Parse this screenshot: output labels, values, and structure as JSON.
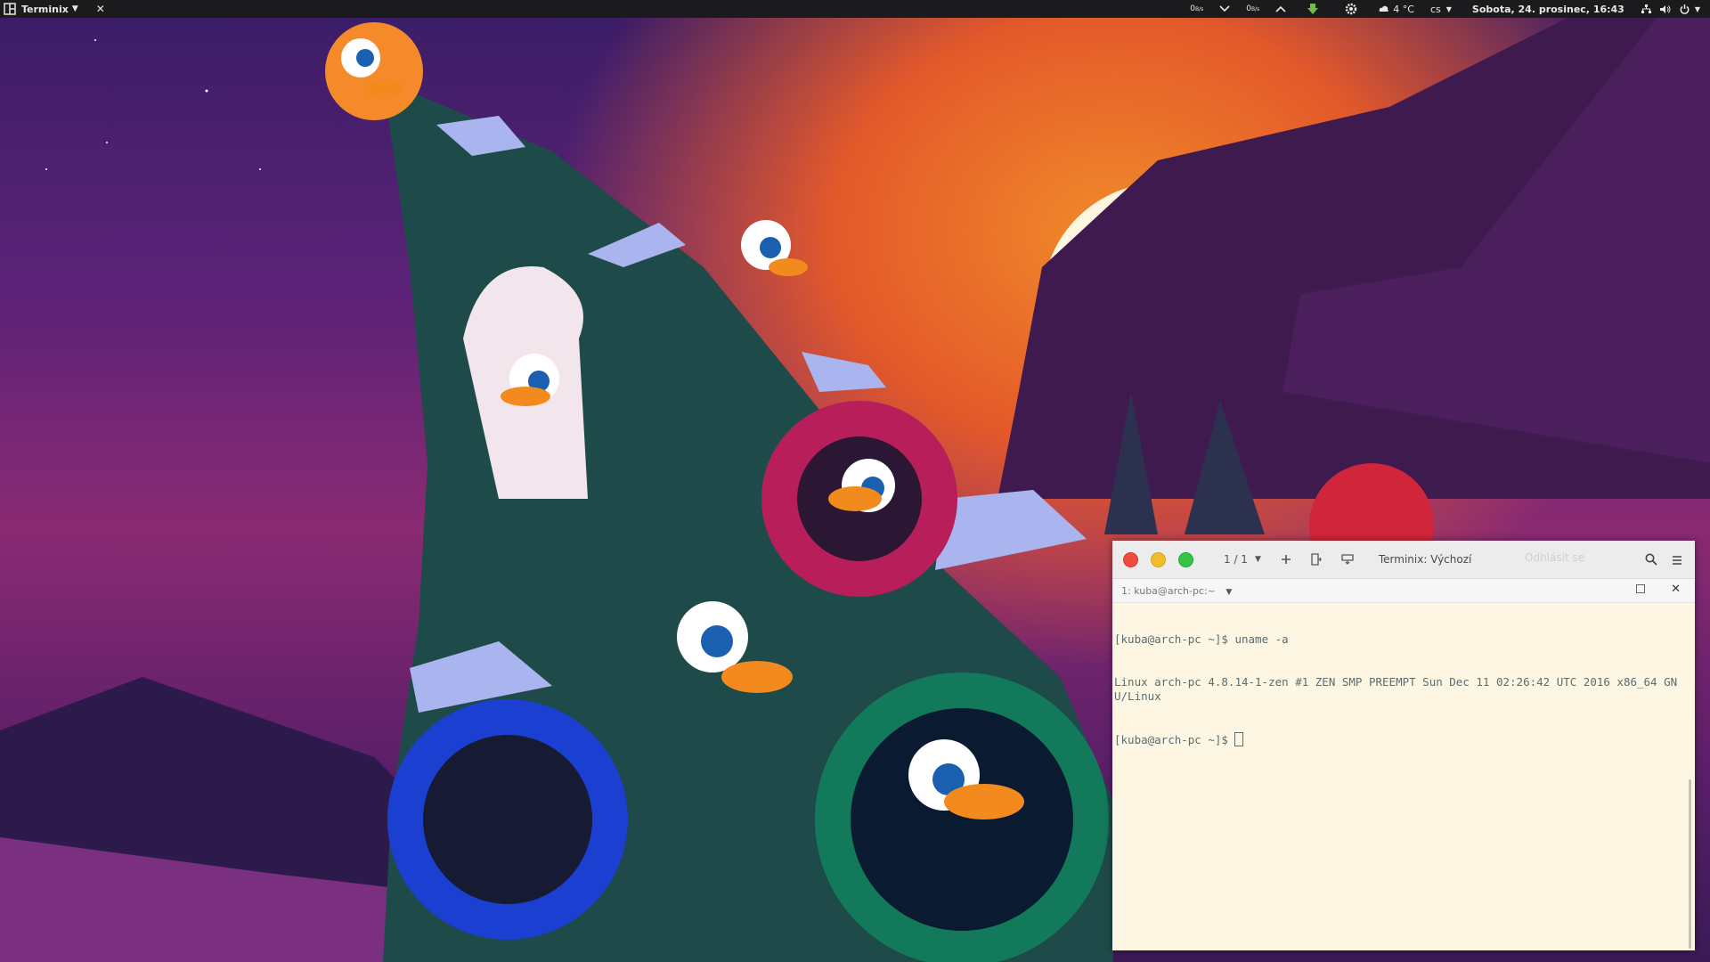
{
  "panel": {
    "app_name": "Terminix",
    "net_down": "0",
    "net_down_unit": "B/s",
    "net_up": "0",
    "net_up_unit": "B/s",
    "weather": "4 °C",
    "keyboard_layout": "cs",
    "clock": "Sobota, 24. prosinec, 16:43"
  },
  "terminal": {
    "session_counter": "1 / 1",
    "title": "Terminix: Výchozí",
    "ghost_text": "Odhlásit se",
    "tab_title": "1: kuba@arch-pc:~",
    "lines": [
      "[kuba@arch-pc ~]$ uname -a",
      "Linux arch-pc 4.8.14-1-zen #1 ZEN SMP PREEMPT Sun Dec 11 02:26:42 UTC 2016 x86_64 GNU/Linux"
    ],
    "prompt": "[kuba@arch-pc ~]$ "
  },
  "colors": {
    "panel_bg": "#1b1b1d",
    "terminal_bg": "#fdf6e3",
    "terminal_fg": "#586e75",
    "close_red": "#ee4b43",
    "minimize_yellow": "#f2bc2b",
    "maximize_green": "#36c34a"
  },
  "icons": {
    "app": "terminix-icon",
    "weather": "cloud-icon",
    "network": "network-icon",
    "volume": "speaker-icon",
    "power": "power-icon",
    "update": "download-arrow-icon",
    "settings": "gear-icon"
  }
}
